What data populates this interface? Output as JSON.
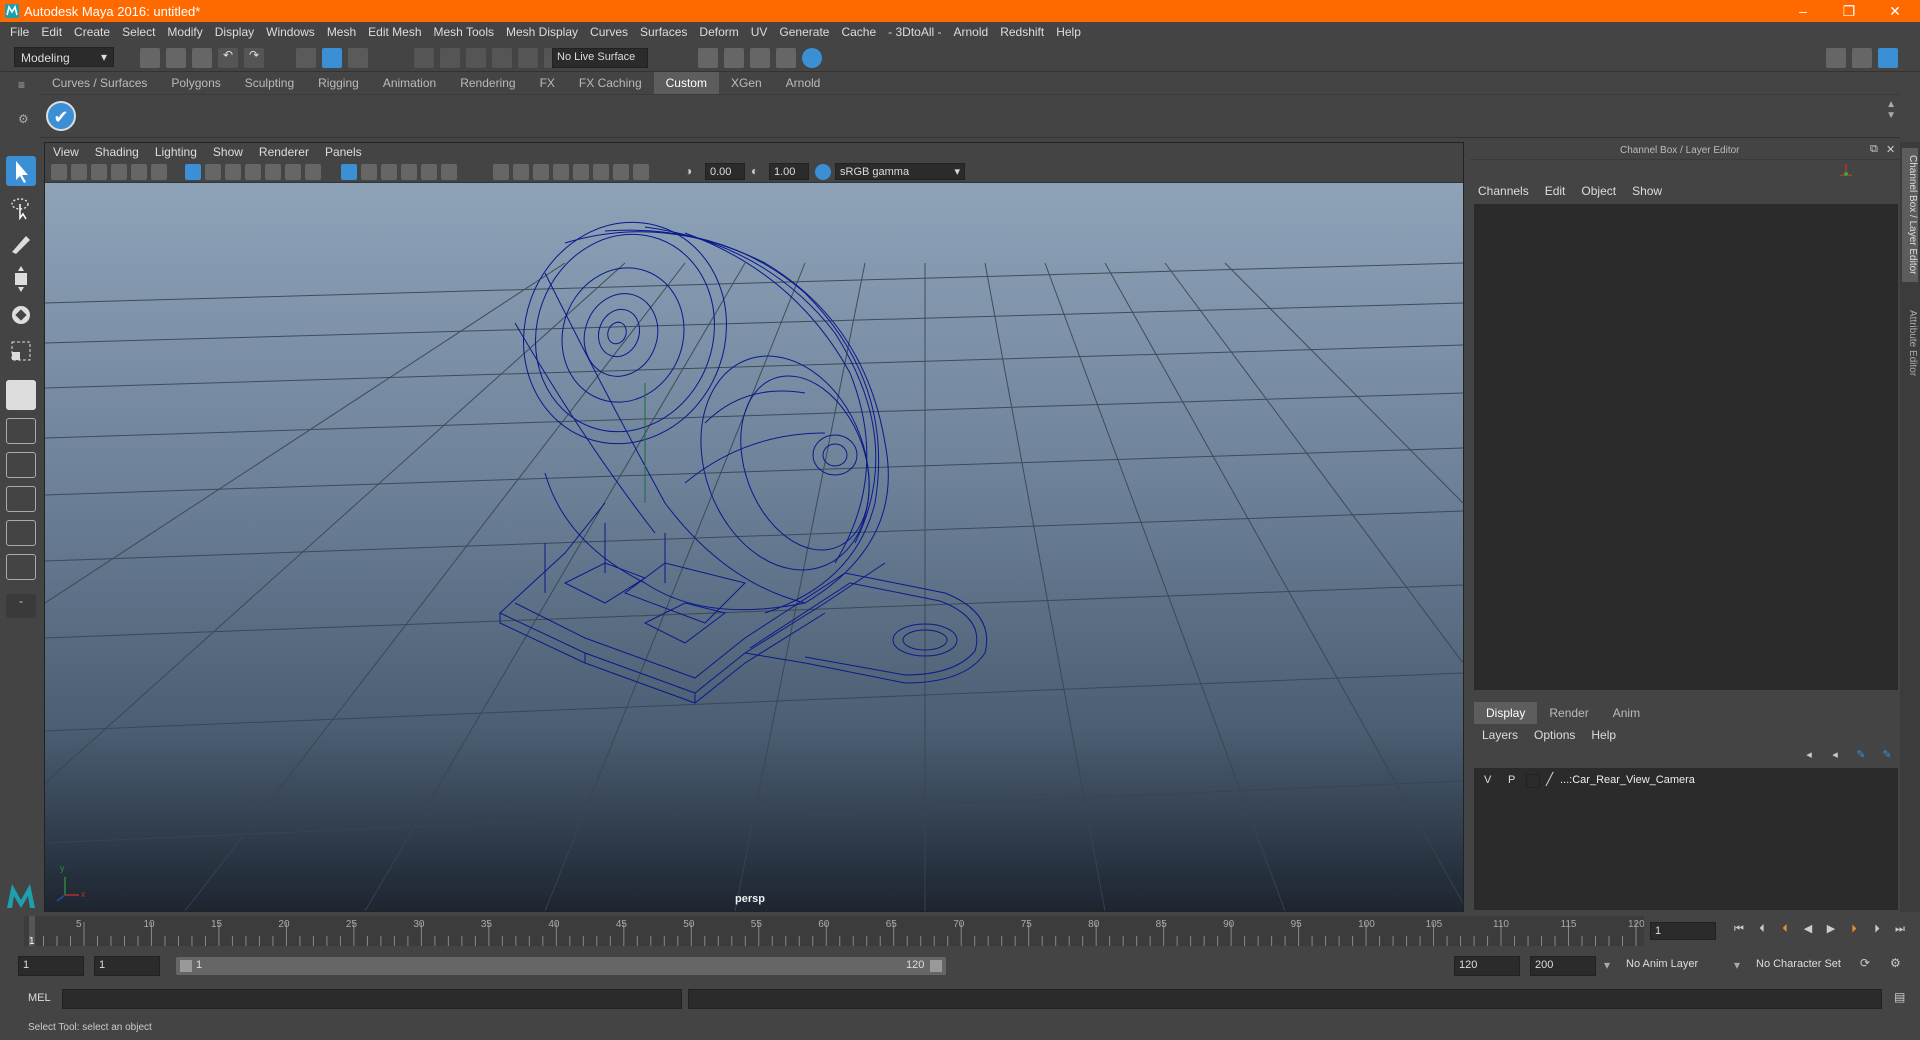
{
  "window": {
    "title": "Autodesk Maya 2016: untitled*"
  },
  "menubar": [
    "File",
    "Edit",
    "Create",
    "Select",
    "Modify",
    "Display",
    "Windows",
    "Mesh",
    "Edit Mesh",
    "Mesh Tools",
    "Mesh Display",
    "Curves",
    "Surfaces",
    "Deform",
    "UV",
    "Generate",
    "Cache",
    "- 3DtoAll -",
    "Arnold",
    "Redshift",
    "Help"
  ],
  "status": {
    "mode": "Modeling",
    "live_surface": "No Live Surface"
  },
  "shelf": {
    "tabs": [
      "Curves / Surfaces",
      "Polygons",
      "Sculpting",
      "Rigging",
      "Animation",
      "Rendering",
      "FX",
      "FX Caching",
      "Custom",
      "XGen",
      "Arnold"
    ],
    "active": "Custom"
  },
  "viewport": {
    "menu": [
      "View",
      "Shading",
      "Lighting",
      "Show",
      "Renderer",
      "Panels"
    ],
    "exposure": "0.00",
    "gamma": "1.00",
    "colorspace": "sRGB gamma",
    "camera_label": "persp",
    "axis_x": "x",
    "axis_y": "y"
  },
  "channelbox": {
    "title": "Channel Box / Layer Editor",
    "menu": [
      "Channels",
      "Edit",
      "Object",
      "Show"
    ],
    "side_tab_1": "Channel Box / Layer Editor",
    "side_tab_2": "Attribute Editor"
  },
  "layers": {
    "tabs": [
      "Display",
      "Render",
      "Anim"
    ],
    "active": "Display",
    "menu": [
      "Layers",
      "Options",
      "Help"
    ],
    "rows": [
      {
        "v": "V",
        "p": "P",
        "name": "...:Car_Rear_View_Camera"
      }
    ]
  },
  "timeline": {
    "ticks": [
      "1",
      "5",
      "10",
      "15",
      "20",
      "25",
      "30",
      "35",
      "40",
      "45",
      "50",
      "55",
      "60",
      "65",
      "70",
      "75",
      "80",
      "85",
      "90",
      "95",
      "100",
      "105",
      "110",
      "115",
      "120"
    ],
    "current_frame": "1"
  },
  "range": {
    "start": "1",
    "playback_start": "1",
    "slider_start": "1",
    "slider_end": "120",
    "playback_end": "120",
    "end": "200",
    "anim_layer": "No Anim Layer",
    "character_set": "No Character Set"
  },
  "cmdline": {
    "label": "MEL"
  },
  "helpline": {
    "text": "Select Tool: select an object"
  },
  "colors": {
    "title_bar": "#ff6a00",
    "wireframe": "#0a1a8a",
    "active_tab": "#5d5d5d",
    "accent_blue": "#3b8fd4"
  }
}
